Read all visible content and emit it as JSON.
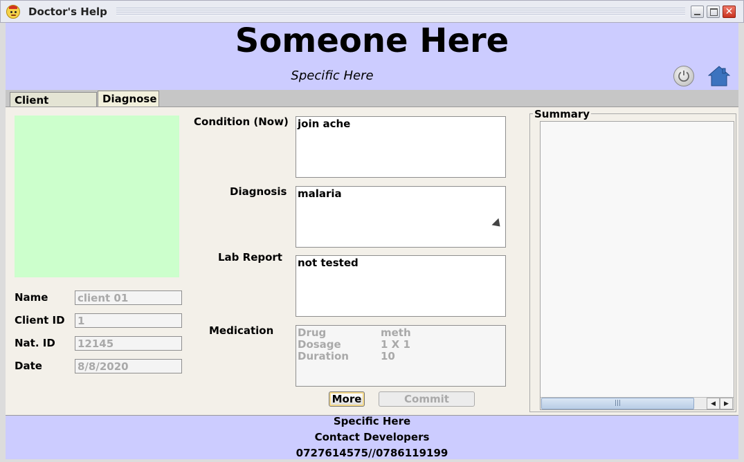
{
  "window": {
    "title": "Doctor's Help",
    "icon": "doctor-face-icon"
  },
  "header": {
    "title": "Someone Here",
    "subtitle": "Specific Here"
  },
  "tabs": [
    {
      "label": "Client History",
      "active": false
    },
    {
      "label": "Diagnose",
      "active": true
    }
  ],
  "client": {
    "name_label": "Name",
    "name_value": "client 01",
    "client_id_label": "Client ID",
    "client_id_value": "1",
    "nat_id_label": "Nat. ID",
    "nat_id_value": "12145",
    "date_label": "Date",
    "date_value": "8/8/2020"
  },
  "diagnose": {
    "condition_label": "Condition (Now)",
    "condition_value": "join ache",
    "diagnosis_label": "Diagnosis",
    "diagnosis_value": "malaria",
    "lab_label": "Lab Report",
    "lab_value": "not tested",
    "medication_label": "Medication",
    "medication": [
      {
        "key": "Drug",
        "value": "meth"
      },
      {
        "key": "Dosage",
        "value": "1 X 1"
      },
      {
        "key": "Duration",
        "value": "10"
      }
    ],
    "more_label": "More",
    "commit_label": "Commit"
  },
  "summary": {
    "label": "Summary"
  },
  "footer": {
    "line1": "Specific Here",
    "line2": "Contact Developers",
    "line3": "0727614575//0786119199"
  },
  "colors": {
    "header_bg": "#ccccff",
    "photo_bg": "#ccffcc",
    "content_bg": "#f3f0e9"
  }
}
